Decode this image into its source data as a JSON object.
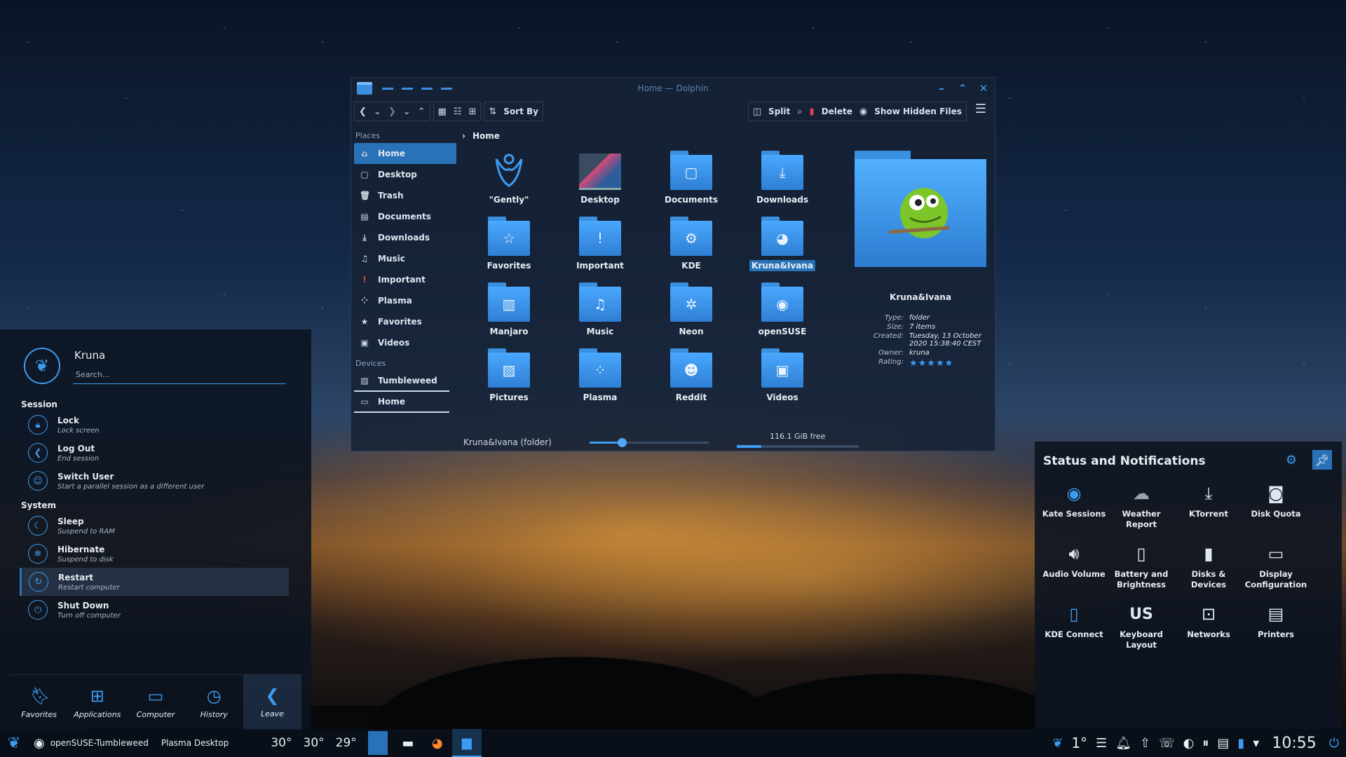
{
  "dolphin": {
    "title": "Home — Dolphin",
    "toolbar": {
      "sort_by": "Sort By",
      "split": "Split",
      "delete": "Delete",
      "show_hidden": "Show Hidden Files"
    },
    "places_header": "Places",
    "places": [
      "Home",
      "Desktop",
      "Trash",
      "Documents",
      "Downloads",
      "Music",
      "Important",
      "Plasma",
      "Favorites",
      "Videos"
    ],
    "devices_header": "Devices",
    "devices": [
      "Tumbleweed",
      "Home"
    ],
    "breadcrumb": "Home",
    "items": [
      "\"Gently\"",
      "Desktop",
      "Documents",
      "Downloads",
      "Favorites",
      "Important",
      "KDE",
      "Kruna&Ivana",
      "Manjaro",
      "Music",
      "Neon",
      "openSUSE",
      "Pictures",
      "Plasma",
      "Reddit",
      "Videos"
    ],
    "info": {
      "name": "Kruna&Ivana",
      "type_k": "Type:",
      "type_v": "folder",
      "size_k": "Size:",
      "size_v": "7 items",
      "created_k": "Created:",
      "created_v": "Tuesday, 13 October 2020 15:38:40 CEST",
      "owner_k": "Owner:",
      "owner_v": "kruna",
      "rating_k": "Rating:",
      "rating_v": "★★★★★"
    },
    "status": "Kruna&Ivana (folder)",
    "zoom_fraction": 0.27,
    "free_space": "116.1 GiB free",
    "disk_used_fraction": 0.2
  },
  "launcher": {
    "user": "Kruna",
    "search_placeholder": "Search...",
    "session_header": "Session",
    "system_header": "System",
    "session": [
      {
        "title": "Lock",
        "sub": "Lock screen"
      },
      {
        "title": "Log Out",
        "sub": "End session"
      },
      {
        "title": "Switch User",
        "sub": "Start a parallel session as a different user"
      }
    ],
    "system": [
      {
        "title": "Sleep",
        "sub": "Suspend to RAM"
      },
      {
        "title": "Hibernate",
        "sub": "Suspend to disk"
      },
      {
        "title": "Restart",
        "sub": "Restart computer"
      },
      {
        "title": "Shut Down",
        "sub": "Turn off computer"
      }
    ],
    "tabs": [
      "Favorites",
      "Applications",
      "Computer",
      "History",
      "Leave"
    ]
  },
  "tray": {
    "title": "Status and Notifications",
    "items": [
      "Kate Sessions",
      "Weather Report",
      "KTorrent",
      "Disk Quota",
      "Audio Volume",
      "Battery and Brightness",
      "Disks & Devices",
      "Display Configuration",
      "KDE Connect",
      "Keyboard Layout",
      "Networks",
      "Printers"
    ],
    "keyboard_layout": "US"
  },
  "panel": {
    "distro": "openSUSE-Tumbleweed",
    "desktop": "Plasma Desktop",
    "temps": [
      "30°",
      "30°",
      "29°"
    ],
    "weather_temp": "1°",
    "clock": "10:55"
  },
  "colors": {
    "accent": "#3d9cf0",
    "selection": "#2a72b8",
    "folder": "#4aa8ff"
  }
}
